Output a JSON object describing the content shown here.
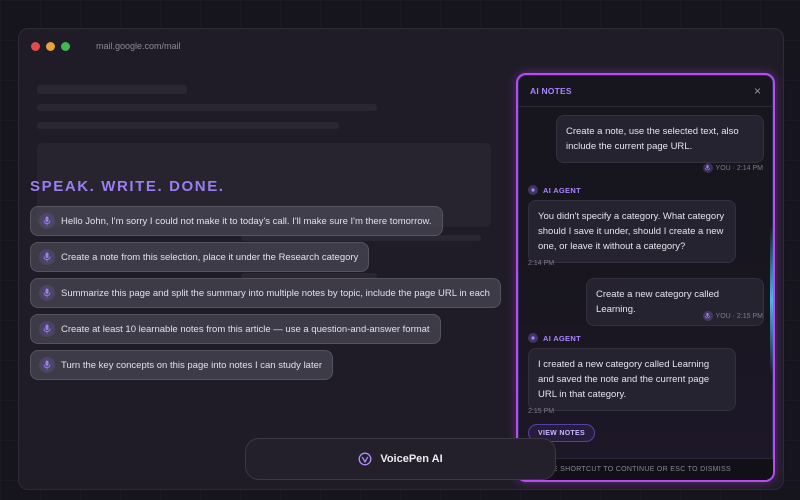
{
  "browser": {
    "url": "mail.google.com/mail"
  },
  "left": {
    "headline": "SPEAK. WRITE. DONE.",
    "prompts": [
      "Hello John, I'm sorry I could not make it to today's call. I'll make sure I'm there tomorrow.",
      "Create a note from this selection, place it under the Research category",
      "Summarize this page and split the summary into multiple notes by topic, include the page URL in each",
      "Create at least 10 learnable notes from this article — use a question-and-answer format",
      "Turn the key concepts on this page into notes I can study later"
    ]
  },
  "voicepen": {
    "label": "VoicePen AI"
  },
  "notes_panel": {
    "title": "AI NOTES",
    "close": "×",
    "messages": {
      "user1_text": "Create a note, use the selected text, also include the current page URL.",
      "user1_meta": "YOU · 2:14 PM",
      "agent1_label": "AI AGENT",
      "agent1_text": "You didn't specify a category. What category should I save it under, should I create a new one, or leave it without a category?",
      "agent1_time": "2:14 PM",
      "user2_text": "Create a new category called Learning.",
      "user2_meta": "YOU · 2:15 PM",
      "agent2_label": "AI AGENT",
      "agent2_text": "I created a new category called Learning and saved the note and the current page URL in that category.",
      "agent2_time": "2:15 PM"
    },
    "view_notes": "VIEW NOTES",
    "footer": "S THE SHORTCUT TO CONTINUE OR ESC TO DISMISS"
  },
  "colors": {
    "accent": "#9b7ef2",
    "panel_border": "#b84cf0",
    "background": "#16141d"
  }
}
